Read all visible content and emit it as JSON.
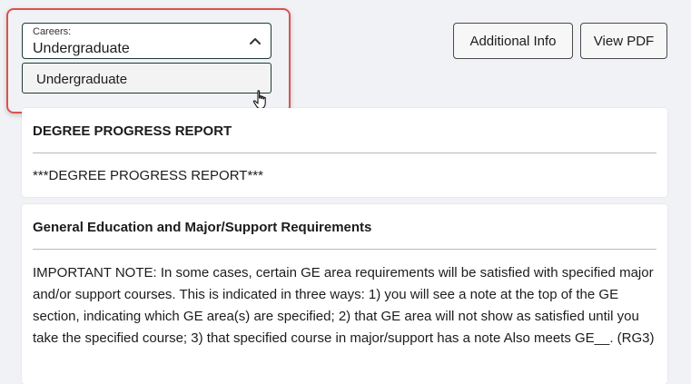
{
  "careers": {
    "label": "Careers:",
    "selected": "Undergraduate",
    "options": [
      "Undergraduate"
    ]
  },
  "buttons": {
    "additional_info": "Additional Info",
    "view_pdf": "View PDF"
  },
  "cards": [
    {
      "title": "DEGREE PROGRESS REPORT",
      "text": "***DEGREE PROGRESS REPORT***"
    },
    {
      "title": "General Education and Major/Support Requirements",
      "text": "IMPORTANT NOTE: In some cases, certain GE area requirements will be satisfied with specified major and/or support courses. This is indicated in three ways: 1) you will see a note at the top of the GE section, indicating which GE area(s) are specified; 2) that GE area will not show as satisfied until you take the specified course; 3) that specified course in major/support has a note Also meets GE__. (RG3)"
    }
  ],
  "icons": {
    "dropdown": "chevron-up-icon",
    "cursor": "hand-pointer-icon"
  },
  "colors": {
    "highlight": "#d9534f",
    "select_border": "#1f3b34",
    "background": "#f1f2f5"
  }
}
